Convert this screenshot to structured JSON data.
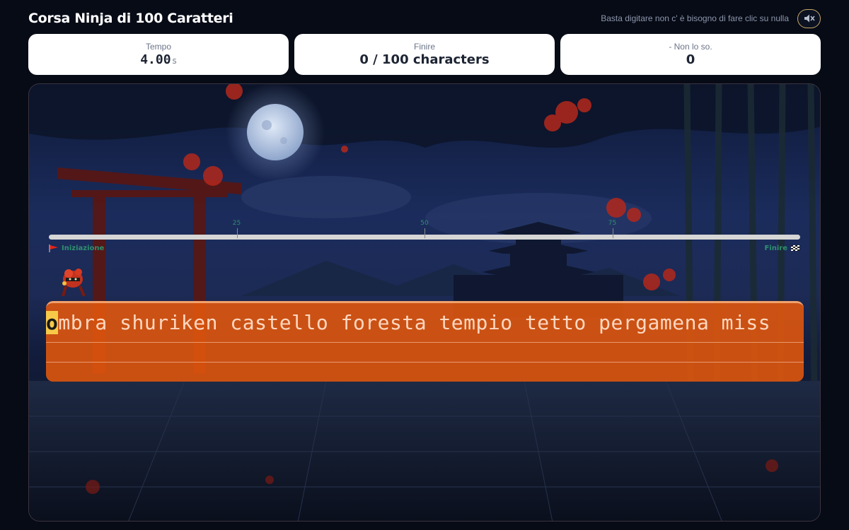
{
  "header": {
    "title": "Corsa Ninja di 100 Caratteri",
    "hint": "Basta digitare non c' è bisogno di fare clic su nulla",
    "sound_icon": "speaker-muted-icon"
  },
  "stats": {
    "time": {
      "label": "Tempo",
      "value": "4.00",
      "unit": "s"
    },
    "finish": {
      "label": "Finire",
      "value": "0 / 100 characters"
    },
    "errors": {
      "label": "- Non lo so.",
      "value": "0"
    }
  },
  "track": {
    "progress_percent": 0,
    "ticks": [
      "25",
      "50",
      "75"
    ],
    "start_label": "Iniziazione",
    "finish_label": "Finire",
    "start_icon": "red-flag-icon",
    "finish_icon": "checkered-flag-icon"
  },
  "typing": {
    "current_char": "o",
    "remaining_text": "mbra shuriken castello foresta tempio tetto pergamena miss"
  },
  "colors": {
    "accent": "#e4580c",
    "cursor": "#f7c948",
    "track": "#d6d6d6",
    "tick_label": "#2f8f6f"
  }
}
